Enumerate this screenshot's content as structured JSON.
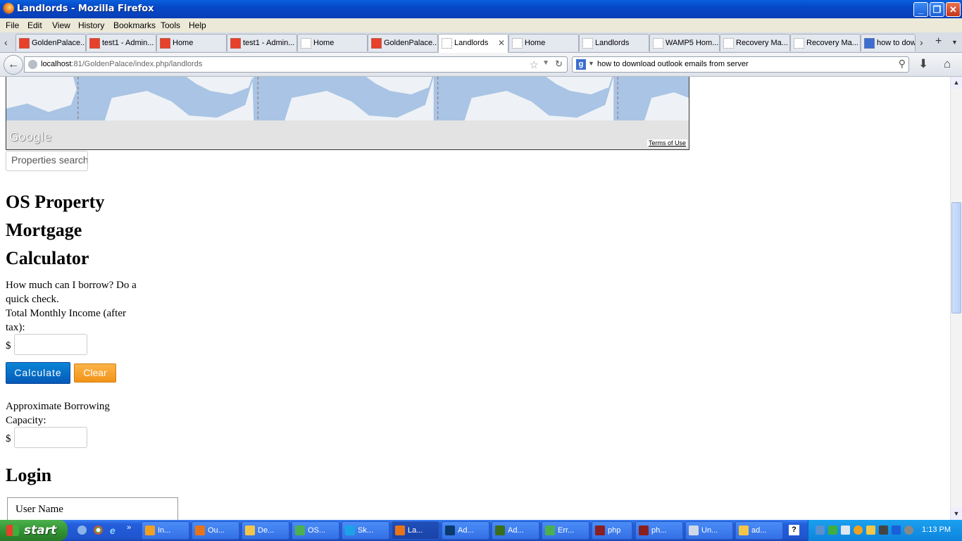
{
  "window": {
    "title": "Landlords - Mozilla Firefox"
  },
  "menu": [
    "File",
    "Edit",
    "View",
    "History",
    "Bookmarks",
    "Tools",
    "Help"
  ],
  "tabs": [
    {
      "label": "GoldenPalace...",
      "icon": "joomla-icon",
      "active": false
    },
    {
      "label": "test1 - Admin...",
      "icon": "joomla-icon",
      "active": false
    },
    {
      "label": "Home",
      "icon": "joomla-icon",
      "active": false
    },
    {
      "label": "test1 - Admin...",
      "icon": "joomla-icon",
      "active": false
    },
    {
      "label": "Home",
      "icon": "page-icon",
      "active": false
    },
    {
      "label": "GoldenPalace...",
      "icon": "joomla-icon",
      "active": false
    },
    {
      "label": "Landlords",
      "icon": "page-icon",
      "active": true
    },
    {
      "label": "Home",
      "icon": "page-icon",
      "active": false
    },
    {
      "label": "Landlords",
      "icon": "page-icon",
      "active": false
    },
    {
      "label": "WAMP5 Hom...",
      "icon": "wamp-icon",
      "active": false
    },
    {
      "label": "Recovery Ma...",
      "icon": "page-icon",
      "active": false
    },
    {
      "label": "Recovery Ma...",
      "icon": "page-icon",
      "active": false
    },
    {
      "label": "how to dow",
      "icon": "google-icon",
      "active": false
    }
  ],
  "nav": {
    "url_host": "localhost",
    "url_rest": ":81/GoldenPalace/index.php/landlords",
    "search_query": "how to download outlook emails from server"
  },
  "map": {
    "brand": "Google",
    "terms": "Terms of Use"
  },
  "property_search": {
    "placeholder": "Properties search"
  },
  "calculator": {
    "title": "OS Property Mortgage Calculator",
    "intro": "How much can I borrow? Do a quick check.",
    "income_label": "Total Monthly Income (after tax):",
    "currency": "$",
    "calculate_label": "Calculate",
    "clear_label": "Clear",
    "result_label": "Approximate Borrowing Capacity:",
    "income_value": "",
    "result_value": ""
  },
  "login": {
    "title": "Login",
    "username_label": "User Name"
  },
  "taskbar": {
    "start_label": "start",
    "tasks": [
      {
        "label": "In...",
        "color": "#f0a020",
        "active": false
      },
      {
        "label": "Ou...",
        "color": "#e8741a",
        "active": false
      },
      {
        "label": "De...",
        "color": "#f3c64a",
        "active": false
      },
      {
        "label": "OS...",
        "color": "#4caf50",
        "active": false
      },
      {
        "label": "Sk...",
        "color": "#1ba3e8",
        "active": false
      },
      {
        "label": "La...",
        "color": "#e8741a",
        "active": true
      },
      {
        "label": "Ad...",
        "color": "#0a3a6e",
        "active": false
      },
      {
        "label": "Ad...",
        "color": "#3a6e1a",
        "active": false
      },
      {
        "label": "Err...",
        "color": "#4caf50",
        "active": false
      },
      {
        "label": "php",
        "color": "#8a1f1f",
        "active": false
      },
      {
        "label": "ph...",
        "color": "#8a1f1f",
        "active": false
      },
      {
        "label": "Un...",
        "color": "#d0d8e8",
        "active": false
      },
      {
        "label": "ad...",
        "color": "#f3c64a",
        "active": false
      }
    ],
    "clock": "1:13 PM"
  }
}
